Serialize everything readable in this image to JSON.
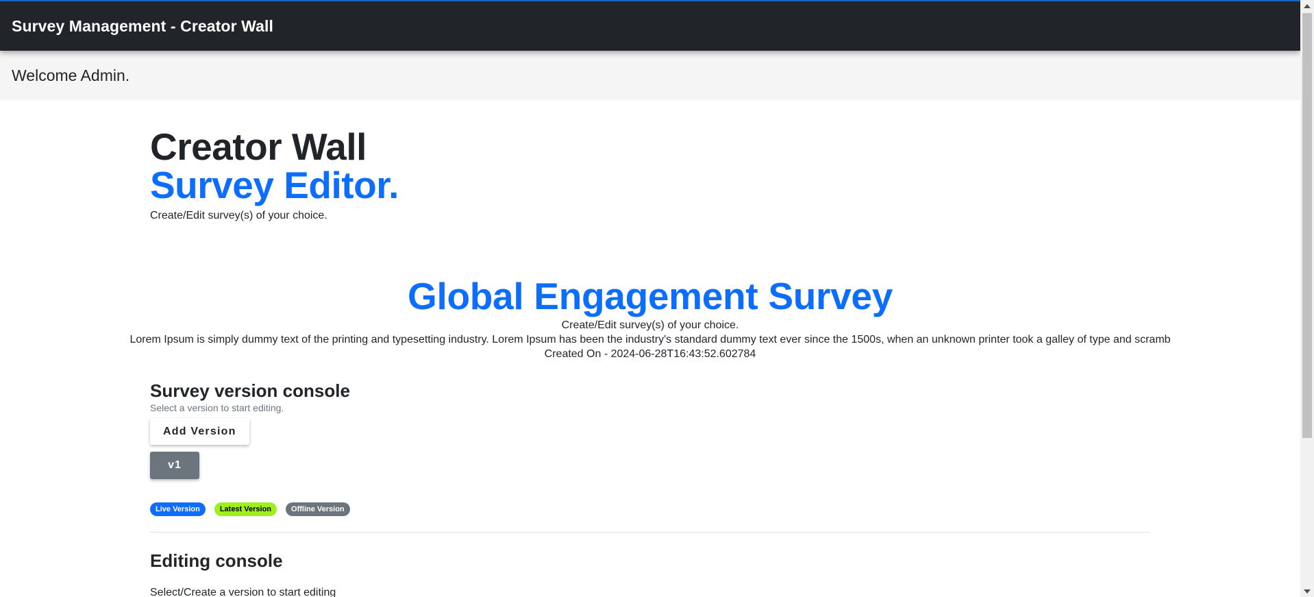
{
  "appbar": {
    "title": "Survey Management - Creator Wall"
  },
  "welcome": {
    "text": "Welcome Admin."
  },
  "hero": {
    "title": "Creator Wall",
    "subtitle": "Survey Editor.",
    "description": "Create/Edit survey(s) of your choice."
  },
  "survey": {
    "title": "Global Engagement Survey",
    "tagline": "Create/Edit survey(s) of your choice.",
    "description": "Lorem Ipsum is simply dummy text of the printing and typesetting industry. Lorem Ipsum has been the industry's standard dummy text ever since the 1500s, when an unknown printer took a galley of type and scramb",
    "created_on": "Created On - 2024-06-28T16:43:52.602784"
  },
  "version_console": {
    "title": "Survey version console",
    "hint": "Select a version to start editing.",
    "add_button_label": "Add Version",
    "versions": [
      "v1"
    ],
    "legend": {
      "live": "Live Version",
      "latest": "Latest Version",
      "offline": "Offline Version"
    }
  },
  "editing_console": {
    "title": "Editing console",
    "hint": "Select/Create a version to start editing"
  },
  "colors": {
    "appbar_bg": "#212529",
    "primary": "#0d6efd",
    "latest_badge": "#9ef01a",
    "offline_badge": "#6c757d"
  }
}
